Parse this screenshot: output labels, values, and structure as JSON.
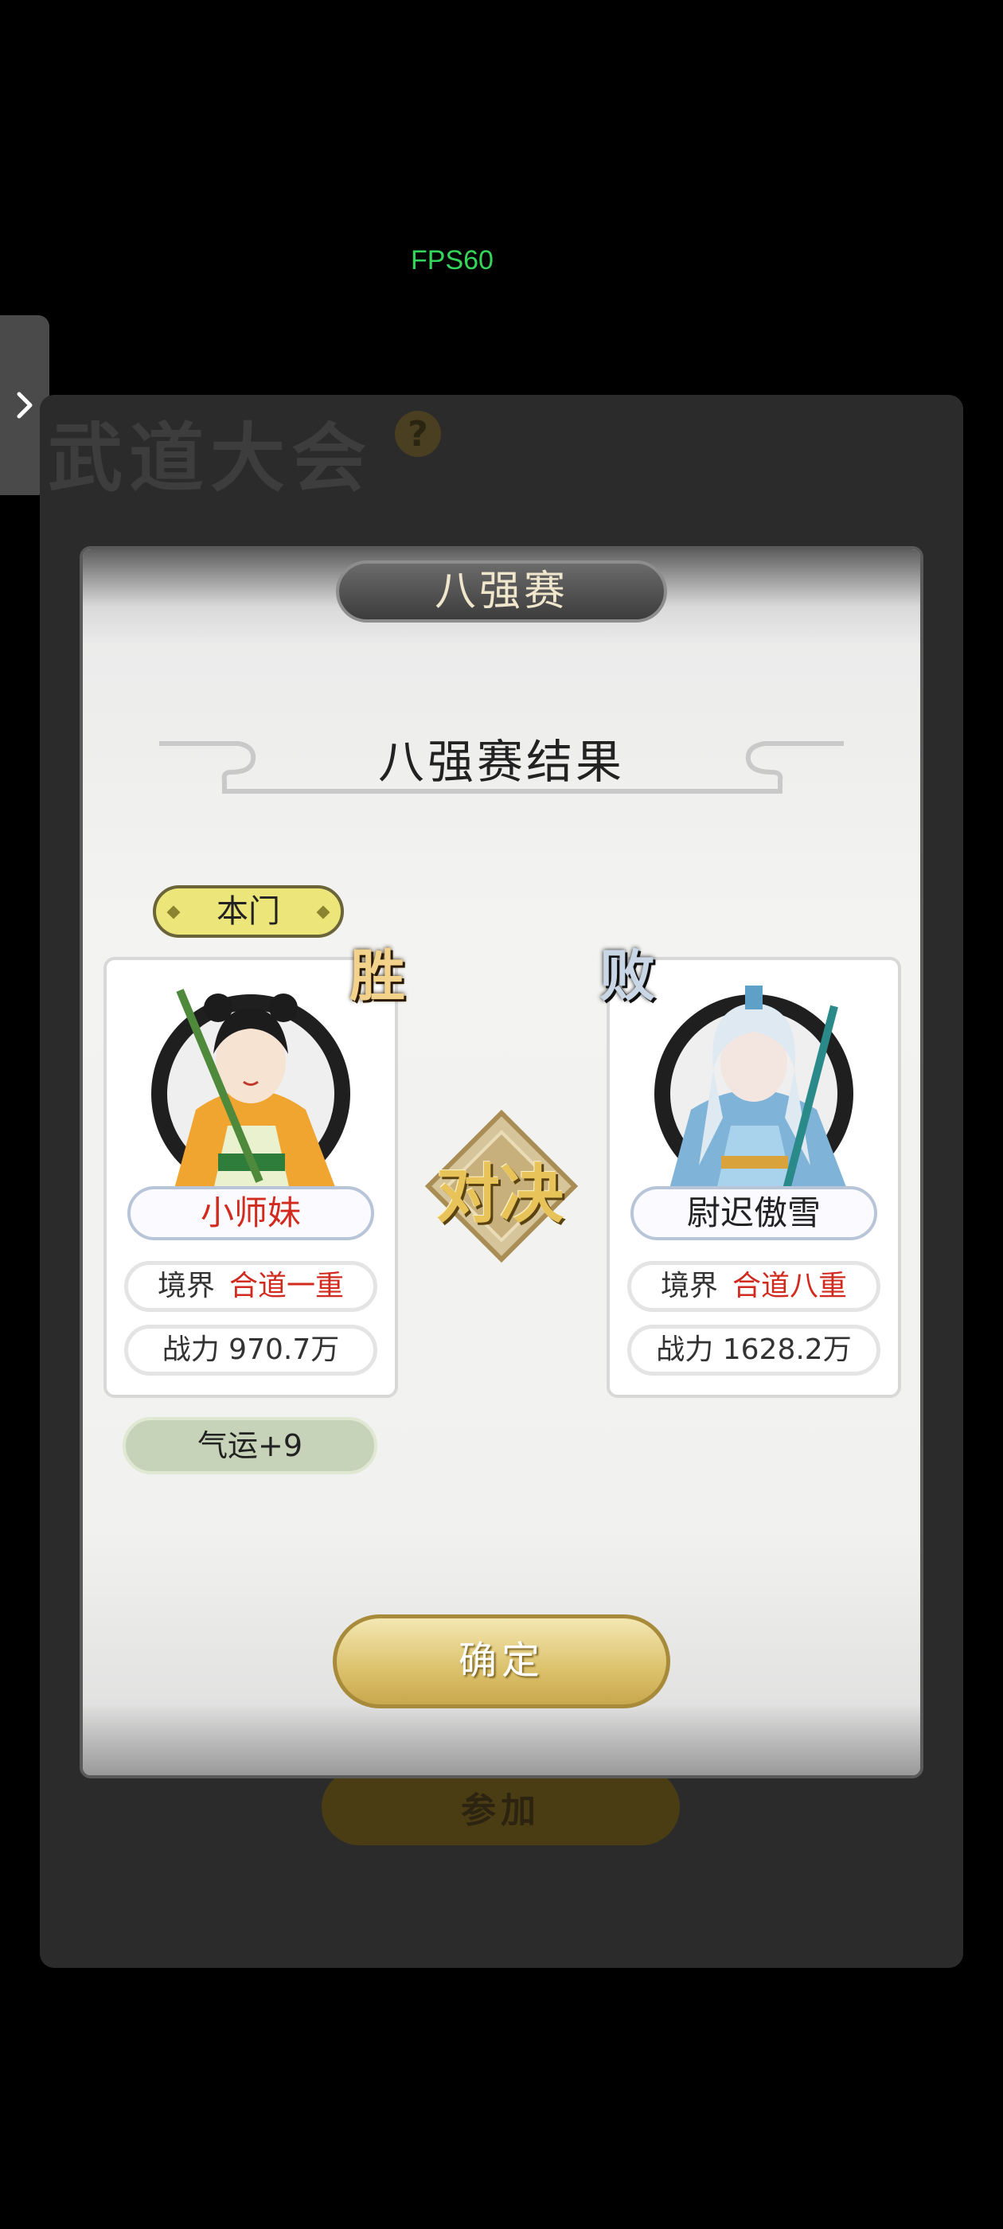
{
  "overlay": {
    "fps": "FPS60"
  },
  "background": {
    "title": "武道大会",
    "help_glyph": "?",
    "join_label": "参加"
  },
  "modal": {
    "stage": "八强赛",
    "result_title": "八强赛结果",
    "vs_label": "对决",
    "confirm_label": "确定"
  },
  "left": {
    "sect_tag": "本门",
    "result": "胜",
    "name": "小师妹",
    "realm_label": "境界",
    "realm_value": "合道一重",
    "power": "战力 970.7万",
    "luck": "气运+9"
  },
  "right": {
    "result": "败",
    "name": "尉迟傲雪",
    "realm_label": "境界",
    "realm_value": "合道八重",
    "power": "战力 1628.2万"
  },
  "colors": {
    "win_gold": "#e7c35a",
    "loss_red_text": "#d12a1e",
    "luck_bg": "#c6d3b8"
  }
}
